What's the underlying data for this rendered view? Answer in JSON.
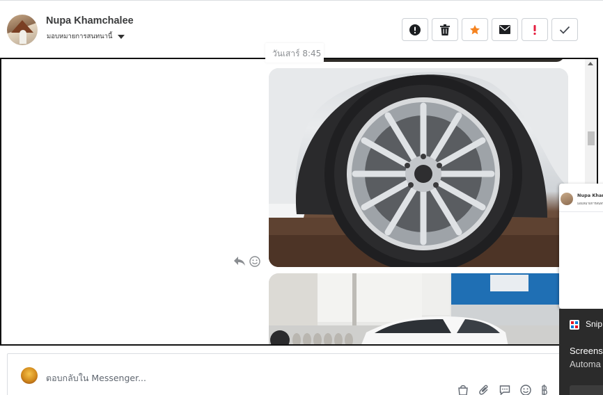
{
  "contact": {
    "name": "Nupa Khamchalee",
    "assign_label": "มอบหมายการสนทนานี้"
  },
  "toolbar": {
    "icons": [
      "alert-circle-icon",
      "trash-icon",
      "star-icon",
      "mail-icon",
      "exclamation-icon",
      "check-icon"
    ],
    "colors": {
      "star": "#f5831f",
      "exclamation": "#e41e3f",
      "icon": "#444950"
    }
  },
  "conversation": {
    "timestamp": "วันเสาร์ 8:45",
    "attachments": [
      "tire-photo",
      "car-photo"
    ]
  },
  "reply": {
    "placeholder": "ตอบกลับใน Messenger..."
  },
  "popup": {
    "name": "Nupa Khamchale"
  },
  "toast": {
    "title": "Snip",
    "line1": "Screens",
    "line2": "Automa"
  }
}
